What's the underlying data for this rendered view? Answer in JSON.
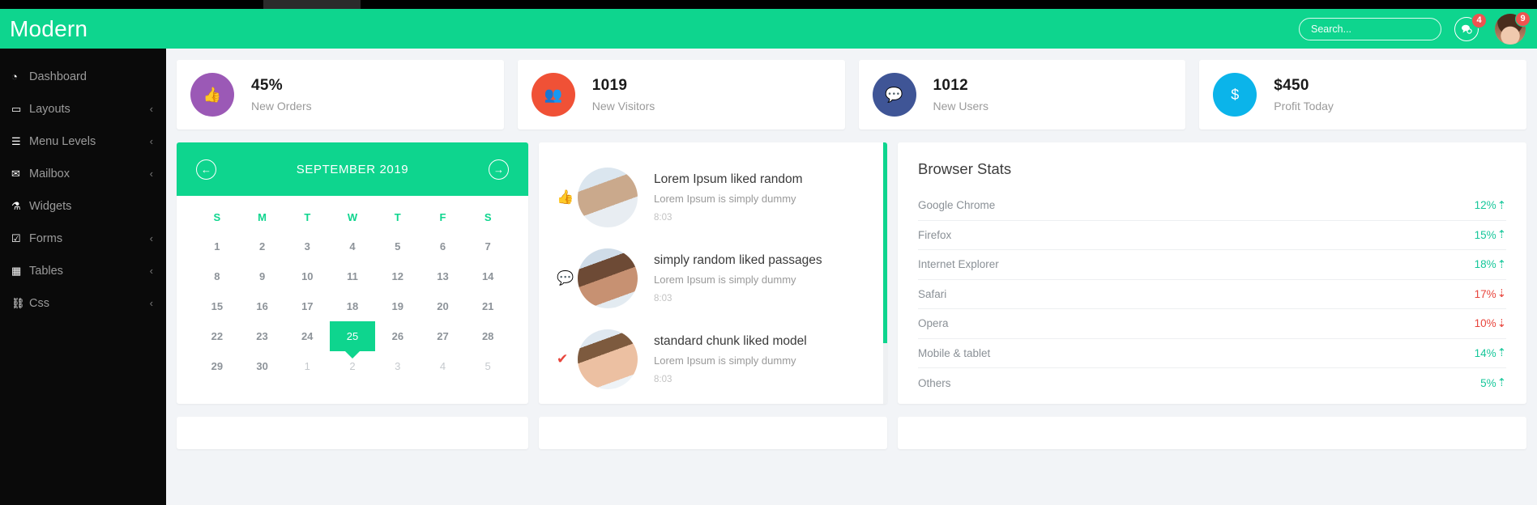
{
  "header": {
    "brand": "Modern",
    "search_placeholder": "Search...",
    "chat_badge": "4",
    "avatar_badge": "9"
  },
  "sidebar": {
    "items": [
      {
        "label": "Dashboard",
        "icon": "dashboard-icon",
        "caret": ""
      },
      {
        "label": "Layouts",
        "icon": "layouts-icon",
        "caret": "‹"
      },
      {
        "label": "Menu Levels",
        "icon": "menu-levels-icon",
        "caret": "‹"
      },
      {
        "label": "Mailbox",
        "icon": "mailbox-icon",
        "caret": "‹"
      },
      {
        "label": "Widgets",
        "icon": "widgets-icon",
        "caret": ""
      },
      {
        "label": "Forms",
        "icon": "forms-icon",
        "caret": "‹"
      },
      {
        "label": "Tables",
        "icon": "tables-icon",
        "caret": "‹"
      },
      {
        "label": "Css",
        "icon": "css-icon",
        "caret": "‹"
      }
    ]
  },
  "stats": [
    {
      "value": "45%",
      "label": "New Orders",
      "color": "#9b59b6",
      "icon": "thumbs-up-icon",
      "glyph": "👍"
    },
    {
      "value": "1019",
      "label": "New Visitors",
      "color": "#f05136",
      "icon": "users-icon",
      "glyph": "👥"
    },
    {
      "value": "1012",
      "label": "New Users",
      "color": "#3f5596",
      "icon": "comment-icon",
      "glyph": "💬"
    },
    {
      "value": "$450",
      "label": "Profit Today",
      "color": "#0bb4ea",
      "icon": "dollar-icon",
      "glyph": "$"
    }
  ],
  "calendar": {
    "title": "SEPTEMBER 2019",
    "prev_label": "←",
    "next_label": "→",
    "dow": [
      "S",
      "M",
      "T",
      "W",
      "T",
      "F",
      "S"
    ],
    "selected": "25",
    "weeks": [
      [
        {
          "d": "1"
        },
        {
          "d": "2"
        },
        {
          "d": "3"
        },
        {
          "d": "4"
        },
        {
          "d": "5"
        },
        {
          "d": "6"
        },
        {
          "d": "7"
        }
      ],
      [
        {
          "d": "8"
        },
        {
          "d": "9"
        },
        {
          "d": "10"
        },
        {
          "d": "11"
        },
        {
          "d": "12"
        },
        {
          "d": "13"
        },
        {
          "d": "14"
        }
      ],
      [
        {
          "d": "15"
        },
        {
          "d": "16"
        },
        {
          "d": "17"
        },
        {
          "d": "18"
        },
        {
          "d": "19"
        },
        {
          "d": "20"
        },
        {
          "d": "21"
        }
      ],
      [
        {
          "d": "22"
        },
        {
          "d": "23"
        },
        {
          "d": "24"
        },
        {
          "d": "25",
          "sel": true
        },
        {
          "d": "26"
        },
        {
          "d": "27"
        },
        {
          "d": "28"
        }
      ],
      [
        {
          "d": "29"
        },
        {
          "d": "30"
        },
        {
          "d": "1",
          "muted": true
        },
        {
          "d": "2",
          "muted": true
        },
        {
          "d": "3",
          "muted": true
        },
        {
          "d": "4",
          "muted": true
        },
        {
          "d": "5",
          "muted": true
        }
      ]
    ]
  },
  "feed": {
    "items": [
      {
        "title": "Lorem Ipsum liked random",
        "sub": "Lorem Ipsum is simply dummy",
        "time": "8:03",
        "icon": "thumbs-up-icon",
        "icon_glyph": "👍",
        "icon_kind": "like"
      },
      {
        "title": "simply random liked passages",
        "sub": "Lorem Ipsum is simply dummy",
        "time": "8:03",
        "icon": "comment-icon",
        "icon_glyph": "💬",
        "icon_kind": "comment"
      },
      {
        "title": "standard chunk liked model",
        "sub": "Lorem Ipsum is simply dummy",
        "time": "8:03",
        "icon": "check-icon",
        "icon_glyph": "✔",
        "icon_kind": "check"
      }
    ]
  },
  "browser_stats": {
    "title": "Browser Stats",
    "rows": [
      {
        "name": "Google Chrome",
        "pct": "12%",
        "dir": "up",
        "arrow": "⇡"
      },
      {
        "name": "Firefox",
        "pct": "15%",
        "dir": "up",
        "arrow": "⇡"
      },
      {
        "name": "Internet Explorer",
        "pct": "18%",
        "dir": "up",
        "arrow": "⇡"
      },
      {
        "name": "Safari",
        "pct": "17%",
        "dir": "down",
        "arrow": "⇣"
      },
      {
        "name": "Opera",
        "pct": "10%",
        "dir": "down",
        "arrow": "⇣"
      },
      {
        "name": "Mobile & tablet",
        "pct": "14%",
        "dir": "up",
        "arrow": "⇡"
      },
      {
        "name": "Others",
        "pct": "5%",
        "dir": "up",
        "arrow": "⇡"
      }
    ]
  },
  "colors": {
    "accent": "#0ed58e",
    "sidebar_bg": "#0a0a0a",
    "page_bg": "#f2f4f7",
    "badge": "#ef5350",
    "up": "#16c79a",
    "down": "#e8453c"
  }
}
